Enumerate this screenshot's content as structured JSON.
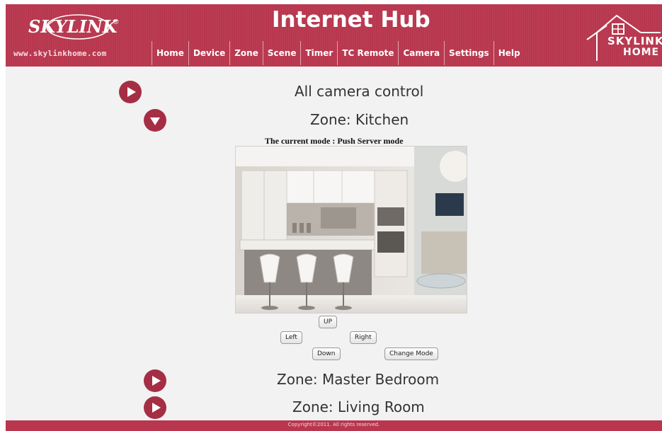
{
  "header": {
    "brand_name": "SKYLINK",
    "brand_url": "www.skylinkhome.com",
    "title": "Internet Hub",
    "house_logo_line1": "SKYLINK",
    "house_logo_line2": "HOME"
  },
  "nav": {
    "items": [
      "Home",
      "Device",
      "Zone",
      "Scene",
      "Timer",
      "TC Remote",
      "Camera",
      "Settings",
      "Help"
    ]
  },
  "main": {
    "all_camera_label": "All camera control",
    "zones": [
      {
        "label": "Zone: Kitchen",
        "expanded": true
      },
      {
        "label": "Zone: Master Bedroom",
        "expanded": false
      },
      {
        "label": "Zone: Living Room",
        "expanded": false
      }
    ],
    "mode_text": "The current mode : Push Server mode",
    "controls": {
      "up": "UP",
      "left": "Left",
      "right": "Right",
      "down": "Down",
      "change_mode": "Change Mode"
    }
  },
  "footer": {
    "text": "Copyright©2011. All rights reserved."
  },
  "colors": {
    "header_bg": "#b8374e",
    "accent": "#a52e45",
    "page_bg": "#f3f2f2"
  }
}
